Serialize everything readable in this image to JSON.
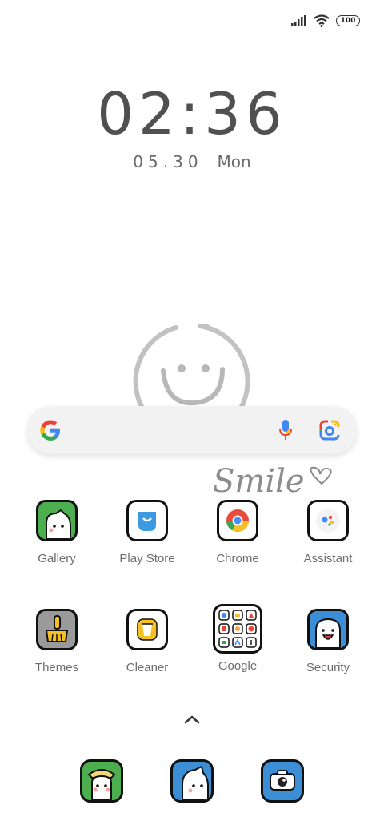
{
  "status_bar": {
    "battery": "100",
    "icons": [
      "signal-icon",
      "wifi-icon",
      "battery-icon"
    ]
  },
  "clock": {
    "time": "02:36",
    "date": "05.30",
    "day": "Mon"
  },
  "widget": {
    "handwriting": "Smile"
  },
  "search": {
    "icons": [
      "google-logo-icon",
      "microphone-icon",
      "google-lens-icon"
    ]
  },
  "apps": [
    {
      "label": "Gallery"
    },
    {
      "label": "Play Store"
    },
    {
      "label": "Chrome"
    },
    {
      "label": "Assistant"
    },
    {
      "label": "Themes"
    },
    {
      "label": "Cleaner"
    },
    {
      "label": "Google"
    },
    {
      "label": "Security"
    }
  ],
  "dock": {
    "apps": [
      "dock-app-bunny-icon",
      "dock-app-ghost-icon",
      "dock-app-camera-icon"
    ]
  },
  "colors": {
    "green": "#4cae4f",
    "blue": "#3c8fd7",
    "yellow": "#f4c026",
    "gray": "#9a9a9a"
  }
}
